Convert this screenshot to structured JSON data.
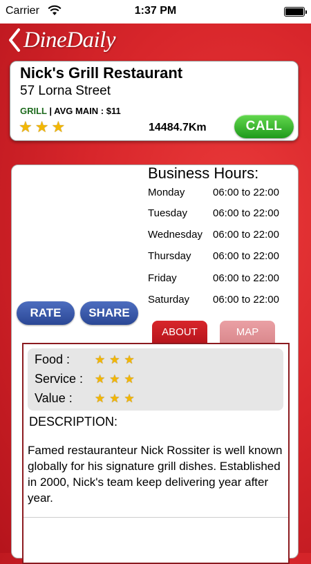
{
  "status_bar": {
    "carrier": "Carrier",
    "time": "1:37 PM"
  },
  "header": {
    "logo": "DineDaily"
  },
  "restaurant": {
    "name": "Nick's Grill Restaurant",
    "address": "57 Lorna Street",
    "cuisine": "GRILL",
    "avg_main": " | AVG MAIN : $11",
    "stars": 3,
    "distance": "14484.7Km",
    "call_label": "CALL"
  },
  "hours": {
    "title": "Business Hours:",
    "days": [
      {
        "day": "Monday",
        "hours": "06:00 to 22:00"
      },
      {
        "day": "Tuesday",
        "hours": "06:00 to 22:00"
      },
      {
        "day": "Wednesday",
        "hours": "06:00 to 22:00"
      },
      {
        "day": "Thursday",
        "hours": "06:00 to 22:00"
      },
      {
        "day": "Friday",
        "hours": "06:00 to 22:00"
      },
      {
        "day": "Saturday",
        "hours": "06:00 to 22:00"
      }
    ]
  },
  "actions": {
    "rate_label": "RATE",
    "share_label": "SHARE"
  },
  "tabs": {
    "about": "ABOUT",
    "map": "MAP",
    "active": "ABOUT"
  },
  "ratings": [
    {
      "label": "Food :",
      "stars": 3
    },
    {
      "label": "Service :",
      "stars": 3
    },
    {
      "label": "Value :",
      "stars": 3
    }
  ],
  "description": {
    "title": "DESCRIPTION:",
    "text": "Famed restauranteur Nick Rossiter is well known globally for his signature grill dishes.  Established in 2000, Nick's team keep delivering year after year."
  },
  "colors": {
    "accent_red": "#d8262b",
    "call_green": "#1f9a1b",
    "button_blue": "#2a4795",
    "cuisine_green": "#1e6b1e",
    "star_gold": "#f2b705"
  }
}
